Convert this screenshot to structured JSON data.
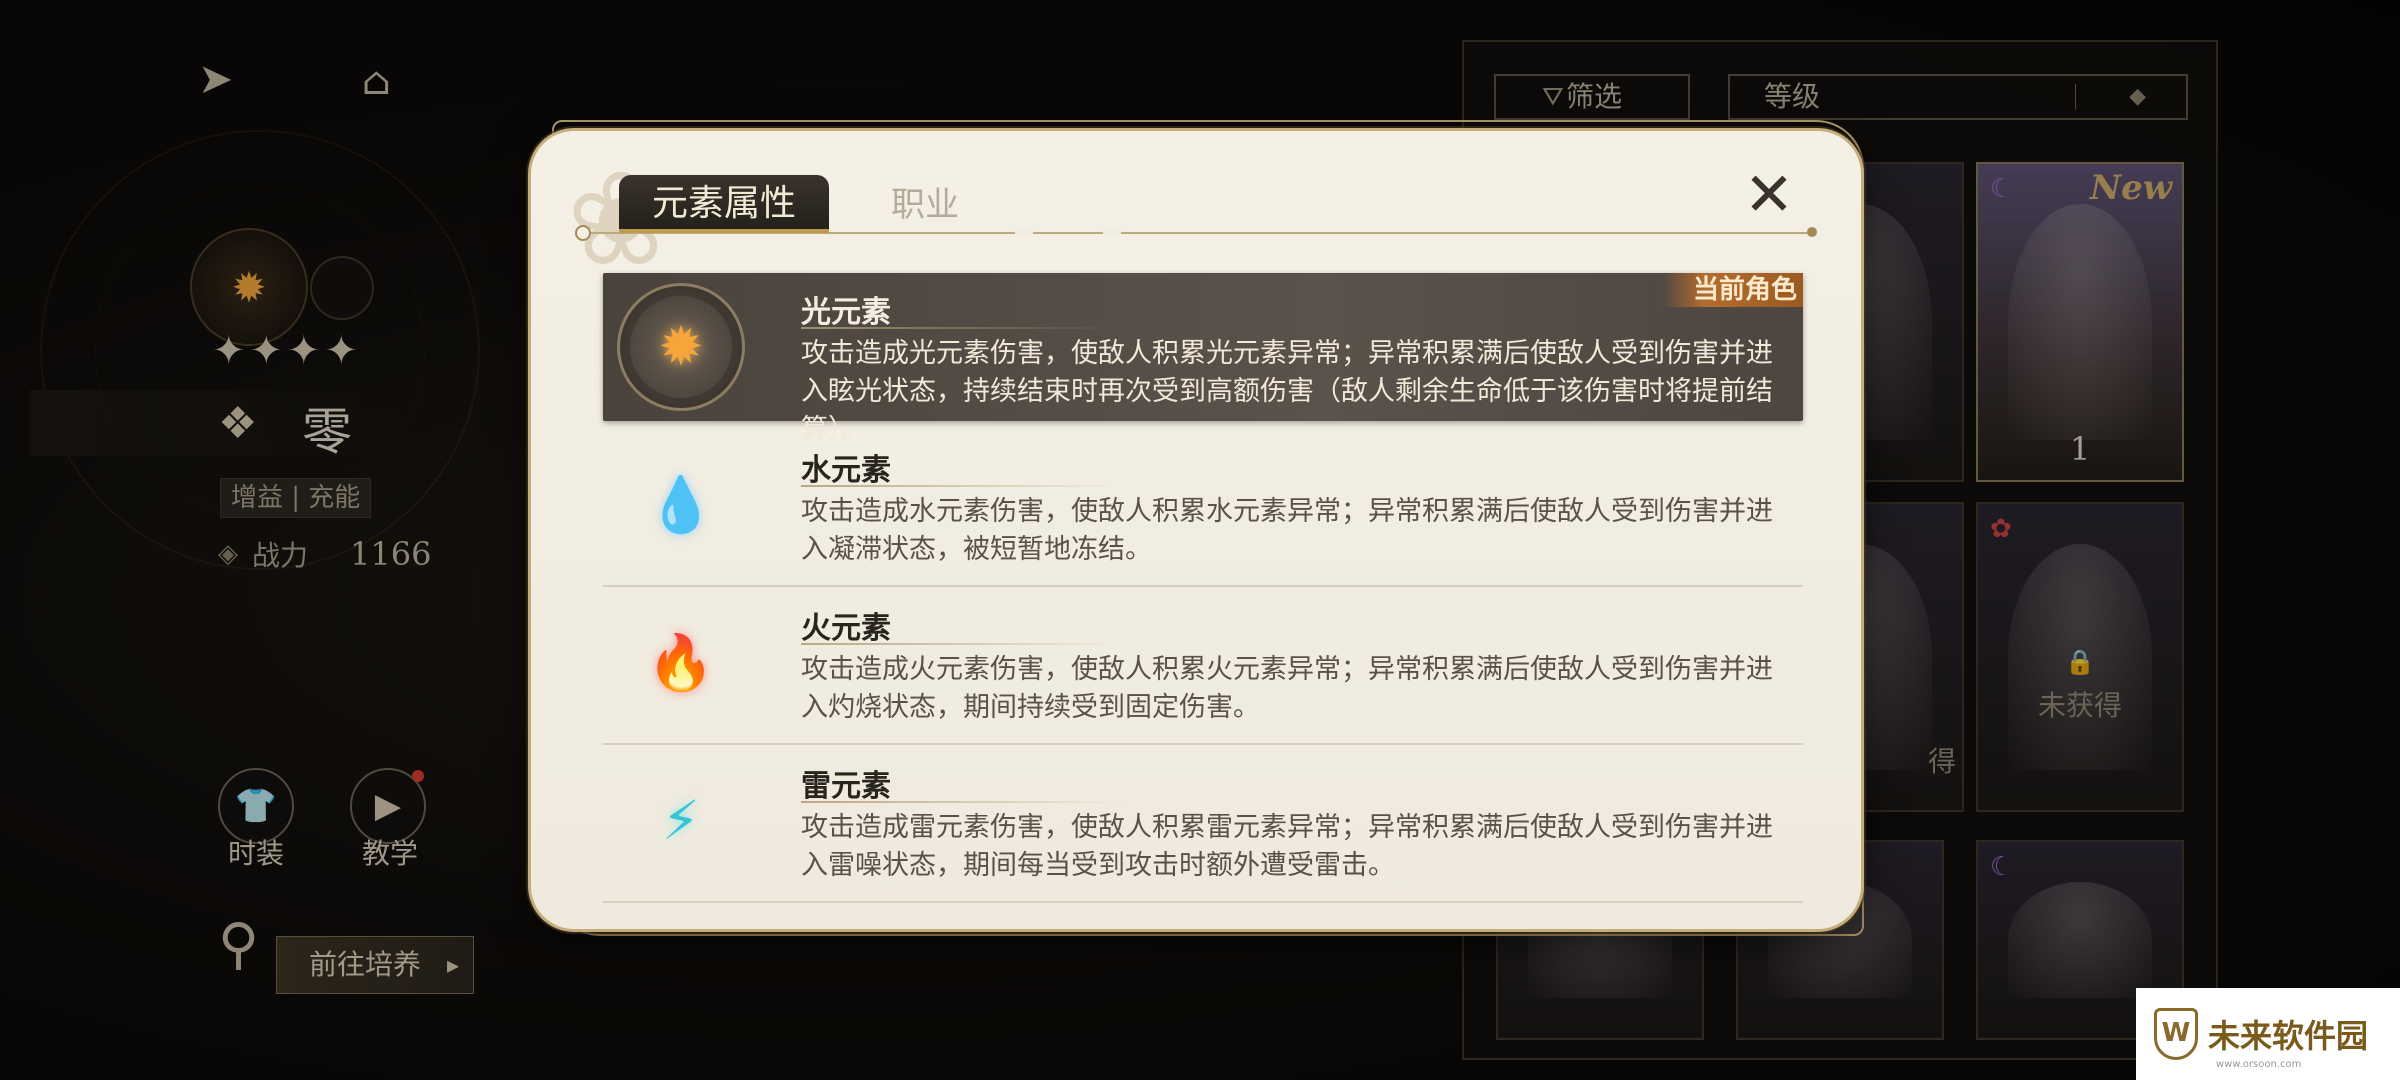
{
  "left_panel": {
    "stars": "✦✦✦✦",
    "character_name": "零",
    "tags": "增益 | 充能",
    "power_label": "战力",
    "power_value": "1166",
    "fashion_label": "时装",
    "tutorial_label": "教学",
    "cultivate_label": "前往培养"
  },
  "roster": {
    "filter_label": "筛选",
    "sort_label": "等级",
    "cards": [
      {
        "badge": "New",
        "number": "1"
      },
      {
        "lock_text": "未获得"
      },
      {
        "side_text": "得"
      }
    ]
  },
  "modal": {
    "tabs": [
      {
        "label": "元素属性",
        "active": true
      },
      {
        "label": "职业",
        "active": false
      }
    ],
    "current_badge": "当前角色",
    "elements": [
      {
        "name": "光元素",
        "icon": "light-element-icon",
        "description": "攻击造成光元素伤害，使敌人积累光元素异常；异常积累满后使敌人受到伤害并进入眩光状态，持续结束时再次受到高额伤害（敌人剩余生命低于该伤害时将提前结算）。",
        "selected": true
      },
      {
        "name": "水元素",
        "icon": "water-element-icon",
        "description": "攻击造成水元素伤害，使敌人积累水元素异常；异常积累满后使敌人受到伤害并进入凝滞状态，被短暂地冻结。",
        "selected": false
      },
      {
        "name": "火元素",
        "icon": "fire-element-icon",
        "description": "攻击造成火元素伤害，使敌人积累火元素异常；异常积累满后使敌人受到伤害并进入灼烧状态，期间持续受到固定伤害。",
        "selected": false
      },
      {
        "name": "雷元素",
        "icon": "thunder-element-icon",
        "description": "攻击造成雷元素伤害，使敌人积累雷元素异常；异常积累满后使敌人受到伤害并进入雷噪状态，期间每当受到攻击时额外遭受雷击。",
        "selected": false
      }
    ]
  },
  "watermark": {
    "text": "未来软件园",
    "url": "www.orsoon.com"
  }
}
